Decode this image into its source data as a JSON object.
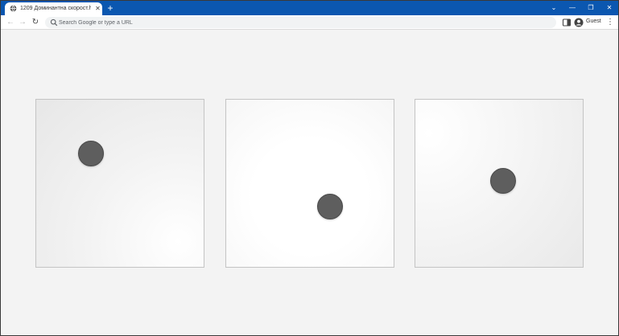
{
  "browser": {
    "tab": {
      "title": "1209 Доминантна скорост.html",
      "close_glyph": "✕",
      "favicon": "globe-icon"
    },
    "new_tab_glyph": "+",
    "window_controls": {
      "dropdown_glyph": "⌄",
      "minimize_glyph": "—",
      "restore_glyph": "❐",
      "close_glyph": "✕"
    },
    "toolbar": {
      "back_glyph": "←",
      "forward_glyph": "→",
      "reload_glyph": "↻",
      "menu_glyph": "⋮"
    },
    "omnibox": {
      "placeholder": "Search Google or type a URL",
      "value": ""
    },
    "profile": {
      "label": "Guest"
    },
    "colors": {
      "tabstrip": "#0b57b0",
      "page_background": "#f3f3f3",
      "dot": "#5e5e5e"
    }
  },
  "page": {
    "panels": [
      {
        "name": "panel-1"
      },
      {
        "name": "panel-2"
      },
      {
        "name": "panel-3"
      }
    ]
  }
}
